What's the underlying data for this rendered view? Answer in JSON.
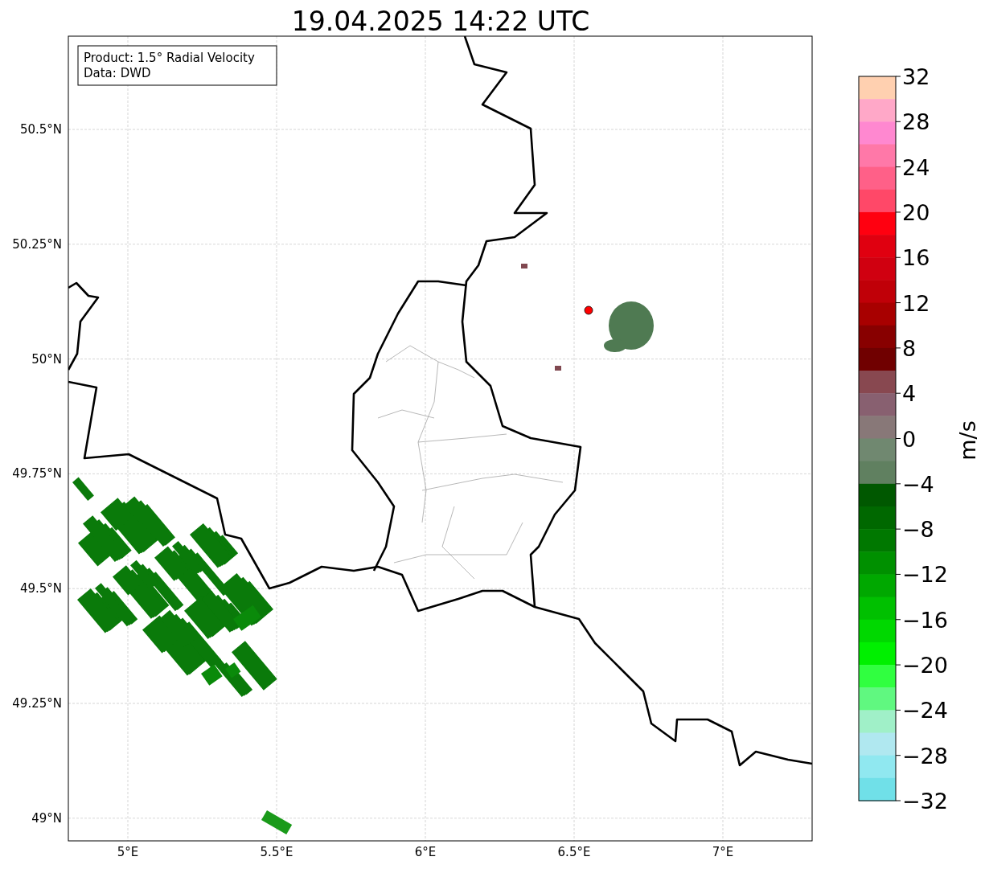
{
  "title": "19.04.2025 14:22 UTC",
  "info_box": [
    "Product: 1.5° Radial Velocity",
    "Data: DWD"
  ],
  "map": {
    "x_ticks": [
      "5°E",
      "5.5°E",
      "6°E",
      "6.5°E",
      "7°E"
    ],
    "y_ticks": [
      "50.5°N",
      "50.25°N",
      "50°N",
      "49.75°N",
      "49.5°N",
      "49.25°N",
      "49°N"
    ]
  },
  "colorbar": {
    "label": "m/s",
    "ticks": [
      "32",
      "28",
      "24",
      "20",
      "16",
      "12",
      "8",
      "4",
      "0",
      "−4",
      "−8",
      "−12",
      "−16",
      "−20",
      "−24",
      "−28",
      "−32"
    ],
    "bins": [
      {
        "color": "#ffd0b0"
      },
      {
        "color": "#ffa8c8"
      },
      {
        "color": "#ff88d0"
      },
      {
        "color": "#ff78a8"
      },
      {
        "color": "#ff6088"
      },
      {
        "color": "#ff4868"
      },
      {
        "color": "#ff0010"
      },
      {
        "color": "#e00010"
      },
      {
        "color": "#d00010"
      },
      {
        "color": "#c00008"
      },
      {
        "color": "#a80000"
      },
      {
        "color": "#880000"
      },
      {
        "color": "#700000"
      },
      {
        "color": "#884850"
      },
      {
        "color": "#886070"
      },
      {
        "color": "#887878"
      },
      {
        "color": "#708870"
      },
      {
        "color": "#608060"
      },
      {
        "color": "#005800"
      },
      {
        "color": "#006800"
      },
      {
        "color": "#007800"
      },
      {
        "color": "#009000"
      },
      {
        "color": "#00a800"
      },
      {
        "color": "#00c000"
      },
      {
        "color": "#00d800"
      },
      {
        "color": "#00f000"
      },
      {
        "color": "#30ff40"
      },
      {
        "color": "#60f880"
      },
      {
        "color": "#a0f0c8"
      },
      {
        "color": "#b0e8f0"
      },
      {
        "color": "#90e8f0"
      },
      {
        "color": "#70e0e8"
      }
    ]
  }
}
